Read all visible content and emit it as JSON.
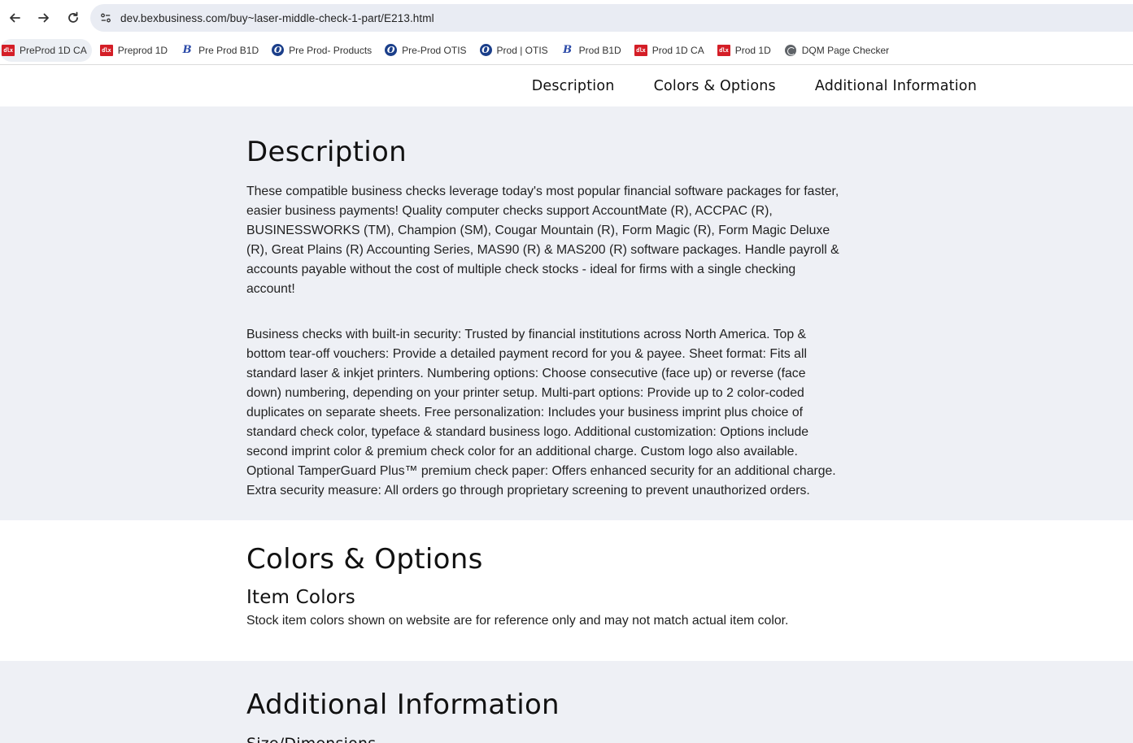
{
  "browser": {
    "url": "dev.bexbusiness.com/buy~laser-middle-check-1-part/E213.html",
    "bookmarks": [
      {
        "label": "PreProd 1D CA",
        "icon": "dlx"
      },
      {
        "label": "Preprod 1D",
        "icon": "dlx"
      },
      {
        "label": "Pre Prod B1D",
        "icon": "b"
      },
      {
        "label": "Pre Prod- Products",
        "icon": "o"
      },
      {
        "label": "Pre-Prod OTIS",
        "icon": "o"
      },
      {
        "label": "Prod | OTIS",
        "icon": "o"
      },
      {
        "label": "Prod B1D",
        "icon": "b"
      },
      {
        "label": "Prod 1D CA",
        "icon": "dlx"
      },
      {
        "label": "Prod 1D",
        "icon": "dlx"
      },
      {
        "label": "DQM Page Checker",
        "icon": "globe"
      }
    ]
  },
  "page_nav": {
    "description": "Description",
    "colors": "Colors & Options",
    "additional": "Additional Information"
  },
  "description": {
    "title": "Description",
    "paragraph1": "These compatible business checks leverage today's most popular financial software packages for faster, easier business payments! Quality computer checks support AccountMate (R), ACCPAC (R), BUSINESSWORKS (TM), Champion (SM), Cougar Mountain (R), Form Magic (R), Form Magic Deluxe (R), Great Plains (R) Accounting Series, MAS90 (R) & MAS200 (R) software packages. Handle payroll & accounts payable without the cost of multiple check stocks - ideal for firms with a single checking account!",
    "paragraph2": "Business checks with built-in security: Trusted by financial institutions across North America. Top & bottom tear-off vouchers: Provide a detailed payment record for you & payee. Sheet format: Fits all standard laser & inkjet printers. Numbering options: Choose consecutive (face up) or reverse (face down) numbering, depending on your printer setup. Multi-part options: Provide up to 2 color-coded duplicates on separate sheets. Free personalization: Includes your business imprint plus choice of standard check color, typeface & standard business logo. Additional customization: Options include second imprint color & premium check color for an additional charge. Custom logo also available. Optional TamperGuard Plus™ premium check paper: Offers enhanced security for an additional charge. Extra security measure: All orders go through proprietary screening to prevent unauthorized orders."
  },
  "colors_options": {
    "title": "Colors & Options",
    "subtitle": "Item Colors",
    "note": "Stock item colors shown on website are for reference only and may not match actual item color."
  },
  "additional_info": {
    "title": "Additional Information",
    "subtitle": "Size/Dimensions"
  }
}
